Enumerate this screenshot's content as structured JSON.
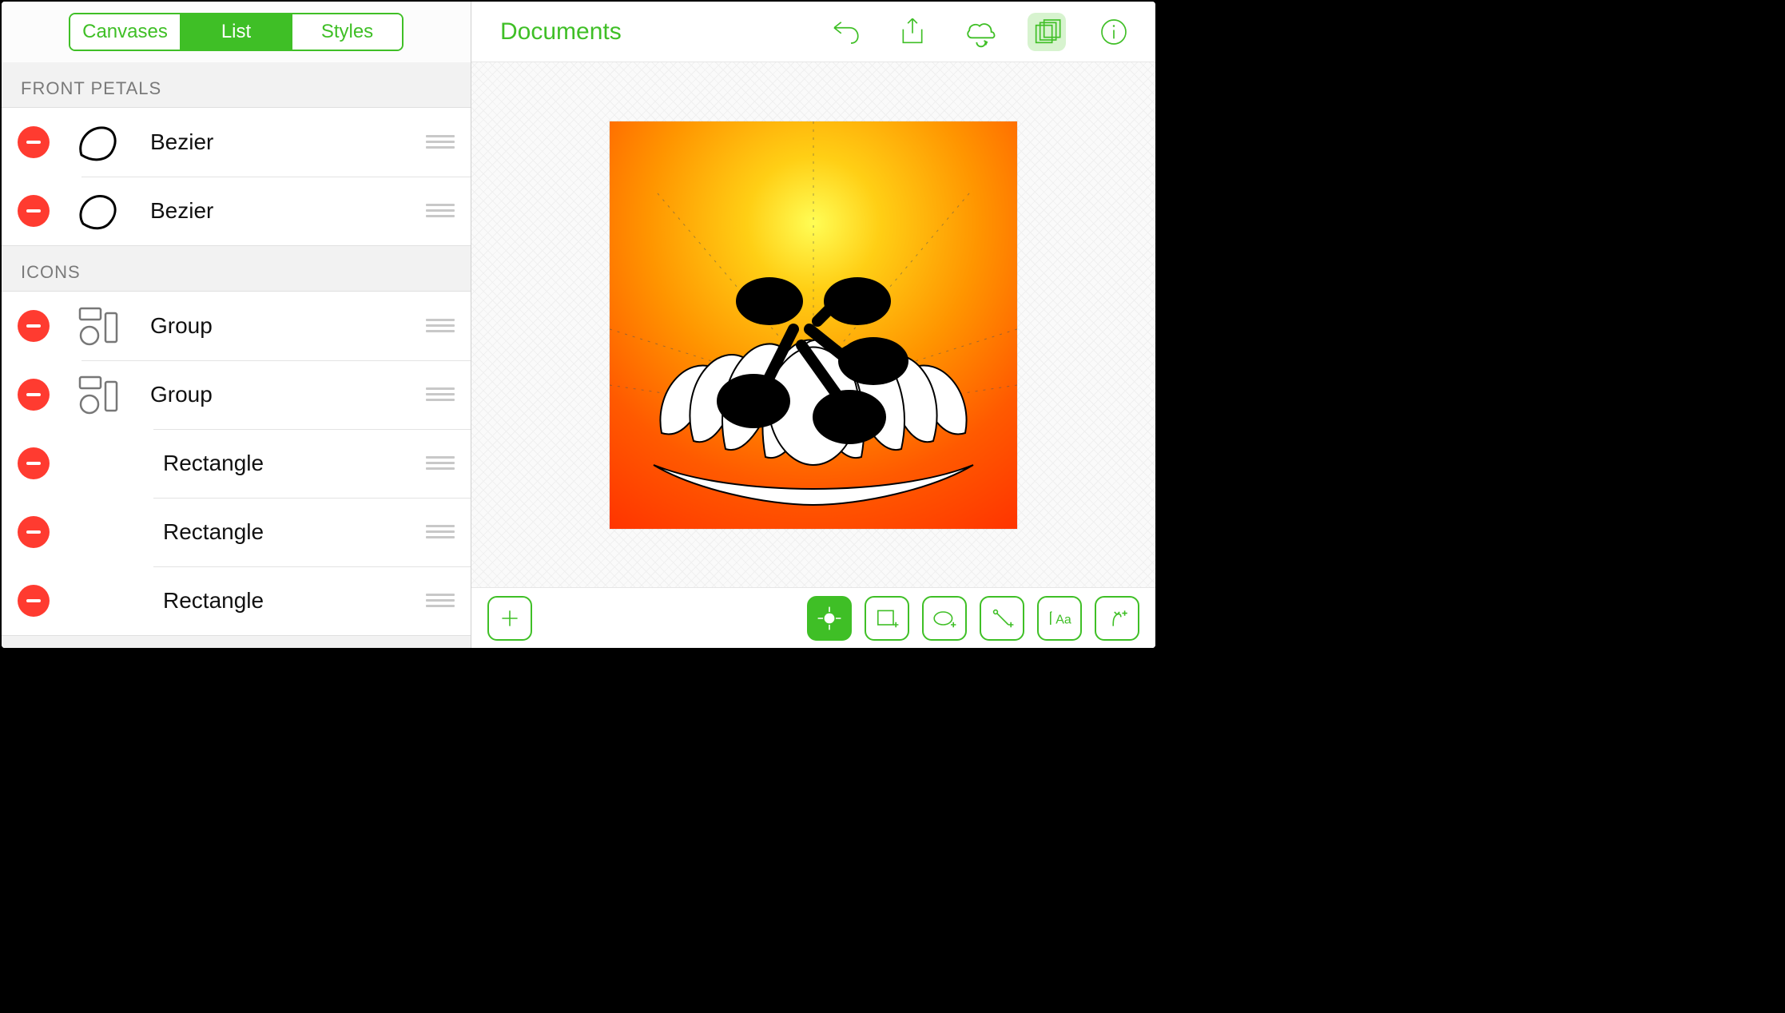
{
  "sidebar": {
    "segments": {
      "canvases": "Canvases",
      "list": "List",
      "styles": "Styles",
      "active": "list"
    },
    "sections": [
      {
        "title": "FRONT PETALS",
        "rows": [
          {
            "label": "Bezier",
            "icon": "petal",
            "indent": 1
          },
          {
            "label": "Bezier",
            "icon": "petal",
            "indent": 1
          }
        ]
      },
      {
        "title": "ICONS",
        "rows": [
          {
            "label": "Group",
            "icon": "group",
            "indent": 1
          },
          {
            "label": "Group",
            "icon": "group",
            "indent": 1
          },
          {
            "label": "Rectangle",
            "icon": "none",
            "indent": 2
          },
          {
            "label": "Rectangle",
            "icon": "none",
            "indent": 2
          },
          {
            "label": "Rectangle",
            "icon": "none",
            "indent": 2
          }
        ]
      }
    ]
  },
  "topbar": {
    "title": "Documents"
  },
  "colors": {
    "accent": "#3fbf26",
    "delete": "#ff3b30"
  }
}
